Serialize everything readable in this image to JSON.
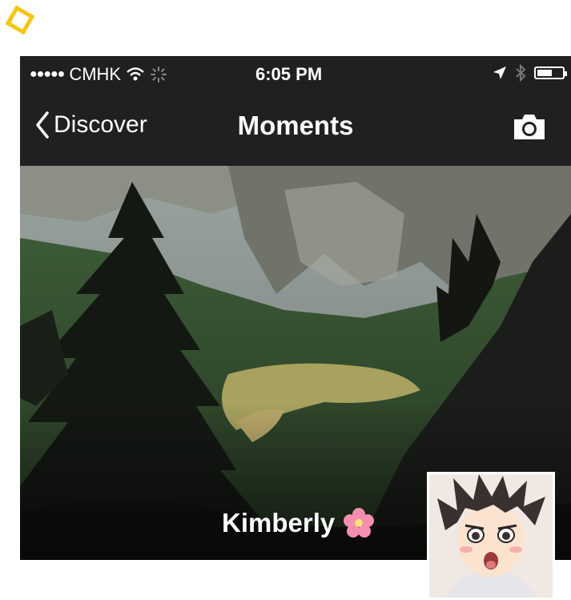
{
  "status_bar": {
    "signal_dots": "●●●●●",
    "carrier": "CMHK",
    "time": "6:05 PM"
  },
  "nav": {
    "back_label": "Discover",
    "title": "Moments"
  },
  "profile": {
    "name": "Kimberly",
    "name_emoji": "flower-icon"
  },
  "icons": {
    "wifi": "wifi-icon",
    "loading": "loading-spinner-icon",
    "location": "location-arrow-icon",
    "bluetooth": "bluetooth-icon",
    "battery": "battery-icon",
    "camera": "camera-icon",
    "back": "chevron-left-icon"
  },
  "colors": {
    "nav_bg": "#1f2022",
    "text": "#ffffff",
    "logo": "#f6c514",
    "flower": "#f48fb1"
  }
}
